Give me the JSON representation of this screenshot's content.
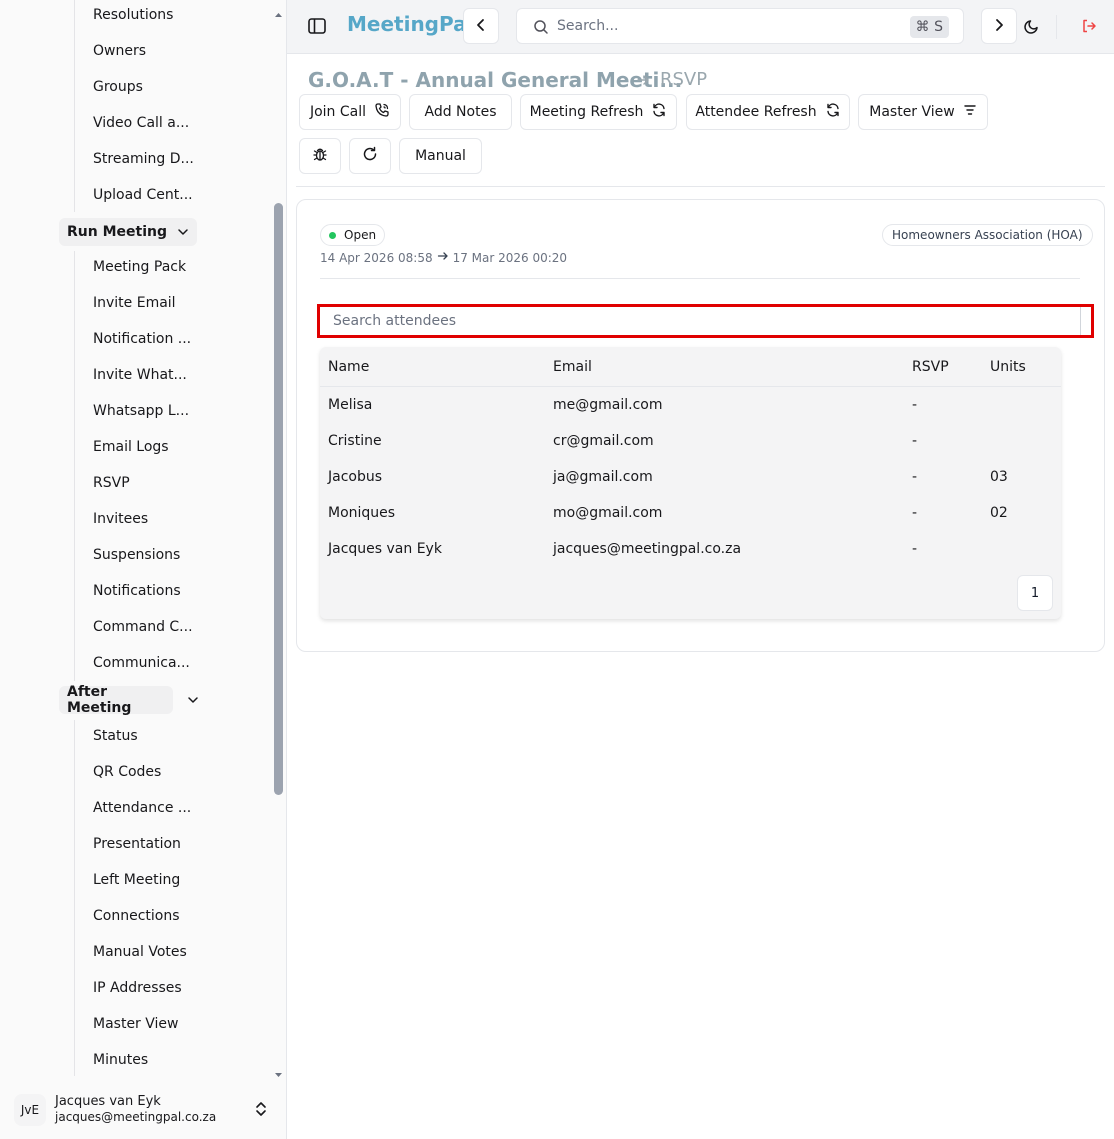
{
  "sidebar": {
    "items_top": [
      "Resolutions",
      "Owners",
      "Groups",
      "Video Call a...",
      "Streaming D...",
      "Upload Cent..."
    ],
    "run_meeting": {
      "label": "Run Meeting",
      "items": [
        "Meeting Pack",
        "Invite Email",
        "Notification ...",
        "Invite What...",
        "Whatsapp L...",
        "Email Logs",
        "RSVP",
        "Invitees",
        "Suspensions",
        "Notifications",
        "Command C...",
        "Communica..."
      ]
    },
    "after_meeting": {
      "label": "After Meeting",
      "items": [
        "Status",
        "QR Codes",
        "Attendance ...",
        "Presentation",
        "Left Meeting",
        "Connections",
        "Manual Votes",
        "IP Addresses",
        "Master View",
        "Minutes"
      ]
    },
    "user": {
      "initials": "JvE",
      "name": "Jacques van Eyk",
      "email": "jacques@meetingpal.co.za"
    }
  },
  "header": {
    "brand": "MeetingPal",
    "search_placeholder": "Search...",
    "shortcut": "⌘ S"
  },
  "page": {
    "title": "G.O.A.T - Annual General Meeti...",
    "crumb": "RSVP",
    "toolbar": {
      "join_call": "Join Call",
      "add_notes": "Add Notes",
      "meeting_refresh": "Meeting Refresh",
      "attendee_refresh": "Attendee Refresh",
      "master_view": "Master View",
      "manual": "Manual"
    }
  },
  "meeting": {
    "status": "Open",
    "start": "14 Apr 2026 08:58",
    "end": "17 Mar 2026 00:20",
    "category": "Homeowners Association (HOA)",
    "status_color": "#22c55e"
  },
  "attendees": {
    "search_placeholder": "Search attendees",
    "columns": [
      "Name",
      "Email",
      "RSVP",
      "Units"
    ],
    "rows": [
      [
        "Melisa",
        "me@gmail.com",
        "-",
        ""
      ],
      [
        "Cristine",
        "cr@gmail.com",
        "-",
        ""
      ],
      [
        "Jacobus",
        "ja@gmail.com",
        "-",
        "03"
      ],
      [
        "Moniques",
        "mo@gmail.com",
        "-",
        "02"
      ],
      [
        "Jacques van Eyk",
        "jacques@meetingpal.co.za",
        "-",
        ""
      ]
    ],
    "page": "1"
  }
}
